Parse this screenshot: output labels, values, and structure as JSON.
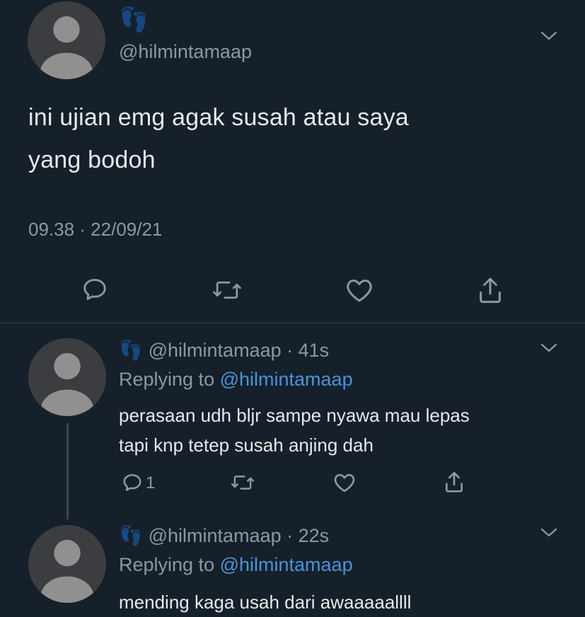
{
  "main_tweet": {
    "name_emoji": "👣",
    "handle": "@hilmintamaap",
    "text_line1": "ini ujian emg agak susah atau saya",
    "text_line2": "yang bodoh",
    "timestamp": "09.38 · 22/09/21"
  },
  "replies": [
    {
      "name_emoji": "👣",
      "handle_time": "@hilmintamaap · 41s",
      "replying_prefix": "Replying to",
      "replying_handle": "@hilmintamaap",
      "text_line1": "perasaan udh bljr sampe nyawa mau lepas",
      "text_line2": "tapi knp tetep susah anjing dah",
      "reply_count": "1"
    },
    {
      "name_emoji": "👣",
      "handle_time": "@hilmintamaap · 22s",
      "replying_prefix": "Replying to",
      "replying_handle": "@hilmintamaap",
      "text_line1": "mending kaga usah dari awaaaaallll"
    }
  ],
  "colors": {
    "background": "#15202b",
    "text": "#e7e9ea",
    "muted": "#8b98a5",
    "link": "#4b93d9"
  },
  "icons": [
    "reply-icon",
    "retweet-icon",
    "like-icon",
    "share-icon",
    "chevron-down-icon",
    "footprints-emoji"
  ]
}
